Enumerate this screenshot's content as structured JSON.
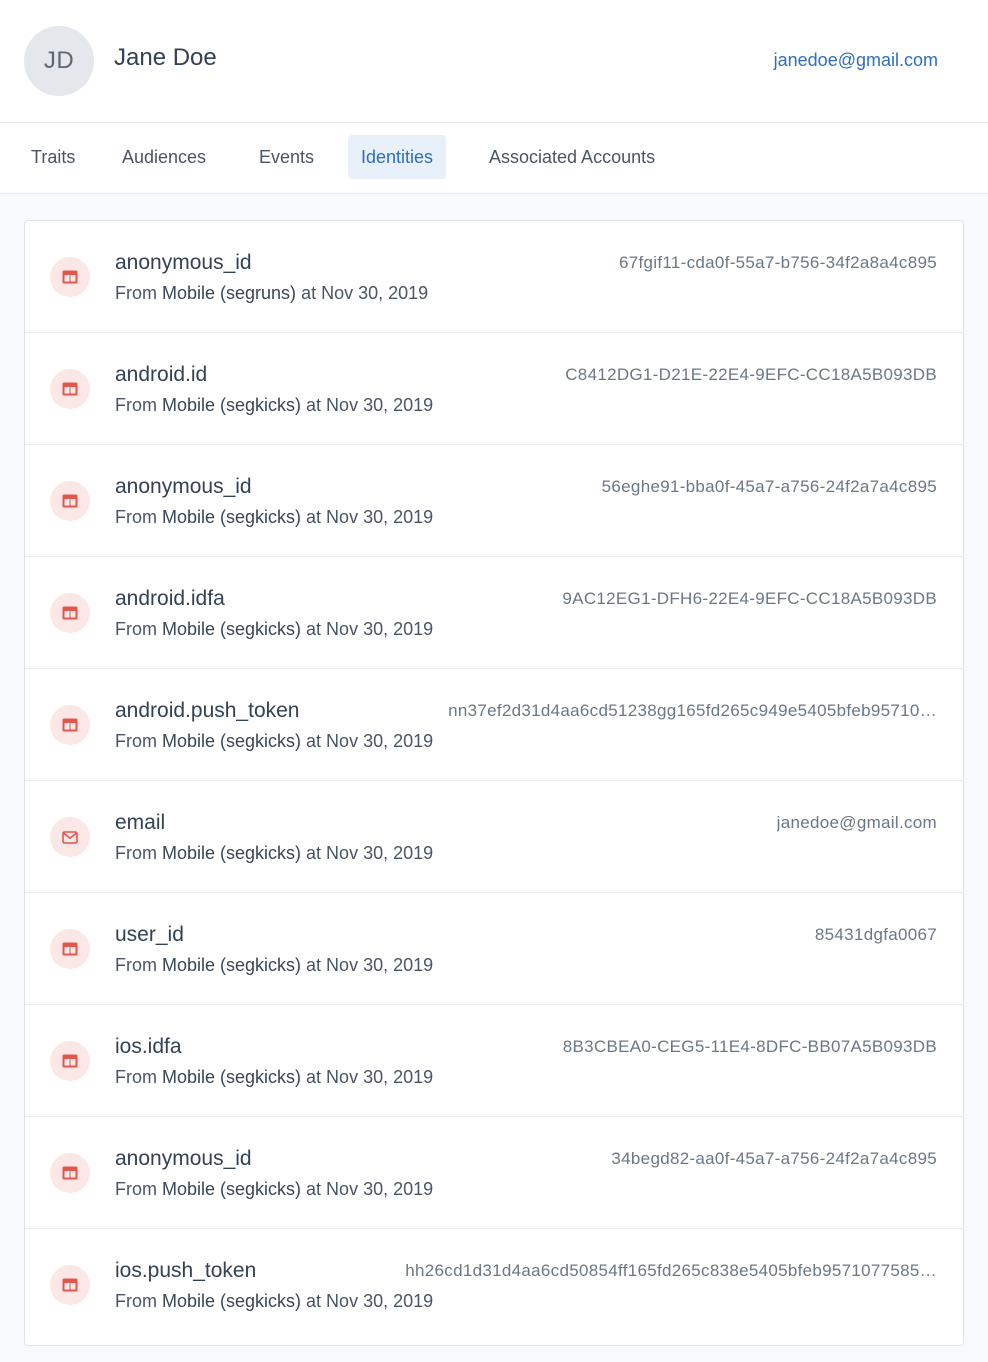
{
  "user": {
    "initials": "JD",
    "name": "Jane Doe",
    "email": "janedoe@gmail.com"
  },
  "tabs": [
    {
      "label": "Traits",
      "active": false
    },
    {
      "label": "Audiences",
      "active": false
    },
    {
      "label": "Events",
      "active": false
    },
    {
      "label": "Identities",
      "active": true
    },
    {
      "label": "Associated Accounts",
      "active": false
    }
  ],
  "identities": [
    {
      "key": "anonymous_id",
      "value": "67fgif11-cda0f-55a7-b756-34f2a8a4c895",
      "icon": "table-icon",
      "source_prefix": "From ",
      "source_name": "Mobile (segruns)",
      "source_suffix": " at Nov 30, 2019"
    },
    {
      "key": "android.id",
      "value": "C8412DG1-D21E-22E4-9EFC-CC18A5B093DB",
      "icon": "table-icon",
      "source_prefix": "From ",
      "source_name": "Mobile (segkicks)",
      "source_suffix": " at Nov 30, 2019"
    },
    {
      "key": "anonymous_id",
      "value": "56eghe91-bba0f-45a7-a756-24f2a7a4c895",
      "icon": "table-icon",
      "source_prefix": "From ",
      "source_name": "Mobile (segkicks)",
      "source_suffix": " at Nov 30, 2019"
    },
    {
      "key": "android.idfa",
      "value": "9AC12EG1-DFH6-22E4-9EFC-CC18A5B093DB",
      "icon": "table-icon",
      "source_prefix": "From ",
      "source_name": "Mobile (segkicks)",
      "source_suffix": " at Nov 30, 2019"
    },
    {
      "key": "android.push_token",
      "value": "nn37ef2d31d4aa6cd51238gg165fd265c949e5405bfeb95710…",
      "icon": "table-icon",
      "source_prefix": "From ",
      "source_name": "Mobile (segkicks)",
      "source_suffix": " at Nov 30, 2019"
    },
    {
      "key": "email",
      "value": "janedoe@gmail.com",
      "icon": "mail-icon",
      "source_prefix": "From ",
      "source_name": "Mobile (segkicks)",
      "source_suffix": " at Nov 30, 2019"
    },
    {
      "key": "user_id",
      "value": "85431dgfa0067",
      "icon": "table-icon",
      "source_prefix": "From ",
      "source_name": "Mobile (segkicks)",
      "source_suffix": " at Nov 30, 2019"
    },
    {
      "key": "ios.idfa",
      "value": "8B3CBEA0-CEG5-11E4-8DFC-BB07A5B093DB",
      "icon": "table-icon",
      "source_prefix": "From ",
      "source_name": "Mobile (segkicks)",
      "source_suffix": " at Nov 30, 2019"
    },
    {
      "key": "anonymous_id",
      "value": "34begd82-aa0f-45a7-a756-24f2a7a4c895",
      "icon": "table-icon",
      "source_prefix": "From ",
      "source_name": "Mobile (segkicks)",
      "source_suffix": " at Nov 30, 2019"
    },
    {
      "key": "ios.push_token",
      "value": "hh26cd1d31d4aa6cd50854ff165fd265c838e5405bfeb9571077585…",
      "icon": "table-icon",
      "source_prefix": "From ",
      "source_name": "Mobile (segkicks)",
      "source_suffix": " at Nov 30, 2019"
    }
  ],
  "colors": {
    "accent": "#2d6fba",
    "icon_red": "#e0574f",
    "icon_bg": "#fbe7e6"
  }
}
